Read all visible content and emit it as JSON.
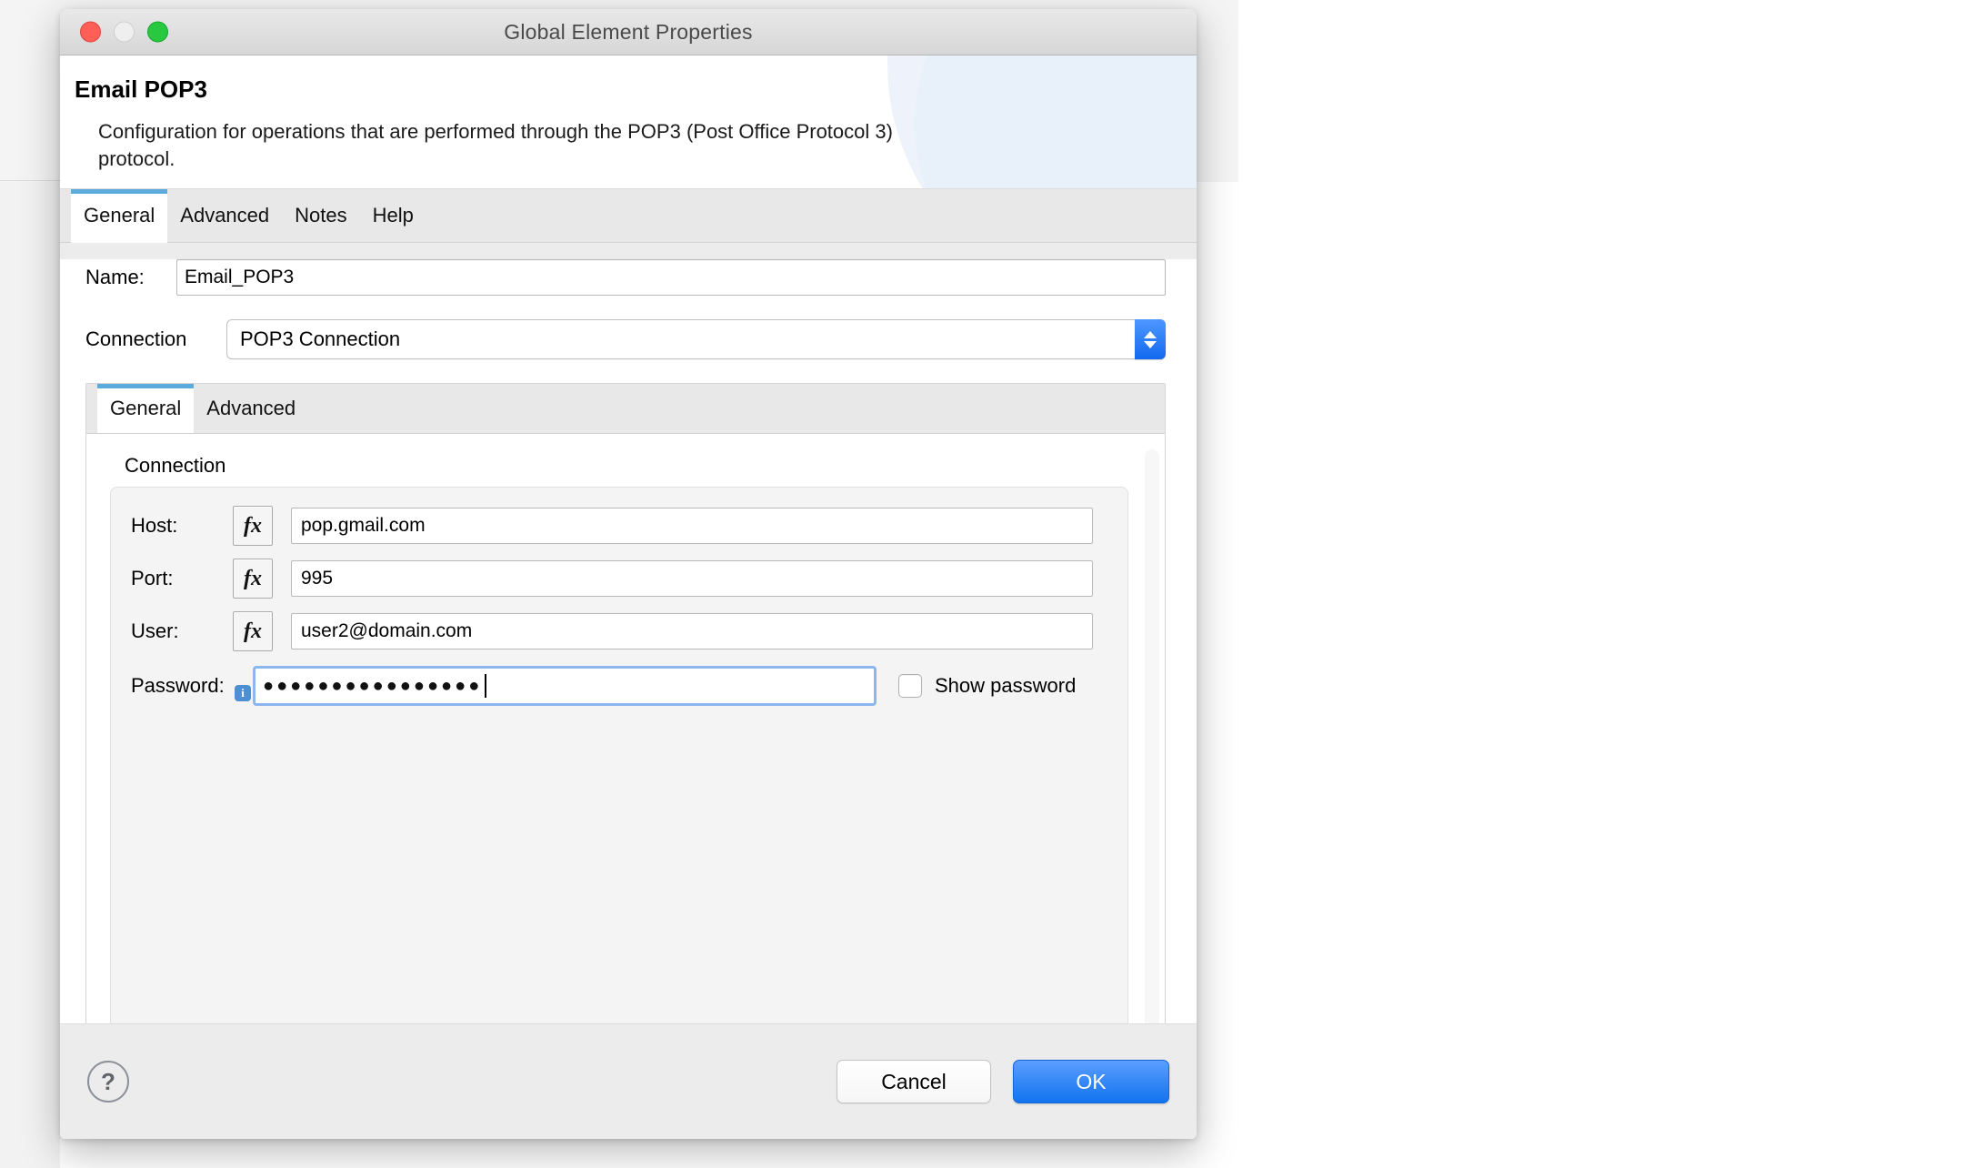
{
  "window": {
    "title": "Global Element Properties",
    "controls": {
      "close": "close-button",
      "minimize": "minimize-button",
      "zoom": "zoom-button"
    }
  },
  "header": {
    "title": "Email POP3",
    "description": "Configuration for operations that are performed through the POP3 (Post Office Protocol 3) protocol."
  },
  "tabs": [
    {
      "label": "General",
      "active": true
    },
    {
      "label": "Advanced",
      "active": false
    },
    {
      "label": "Notes",
      "active": false
    },
    {
      "label": "Help",
      "active": false
    }
  ],
  "form": {
    "name_label": "Name:",
    "name_value": "Email_POP3",
    "connection_label": "Connection",
    "connection_value": "POP3 Connection"
  },
  "inner_tabs": [
    {
      "label": "General",
      "active": true
    },
    {
      "label": "Advanced",
      "active": false
    }
  ],
  "connection_group": {
    "legend": "Connection",
    "fields": [
      {
        "label": "Host:",
        "value": "pop.gmail.com",
        "fx": "fx"
      },
      {
        "label": "Port:",
        "value": "995",
        "fx": "fx"
      },
      {
        "label": "User:",
        "value": "user2@domain.com",
        "fx": "fx"
      }
    ],
    "password": {
      "label": "Password:",
      "masked_value": "●●●●●●●●●●●●●●●●",
      "info_badge": "i",
      "show_password_label": "Show password",
      "show_password_checked": false
    }
  },
  "footer": {
    "help_glyph": "?",
    "cancel_label": "Cancel",
    "ok_label": "OK"
  },
  "colors": {
    "accent_blue": "#1273ef",
    "tab_indicator": "#5aabdc",
    "focus_ring": "#8cb6ef",
    "traffic_red": "#ff5f57",
    "traffic_green": "#28c840"
  }
}
